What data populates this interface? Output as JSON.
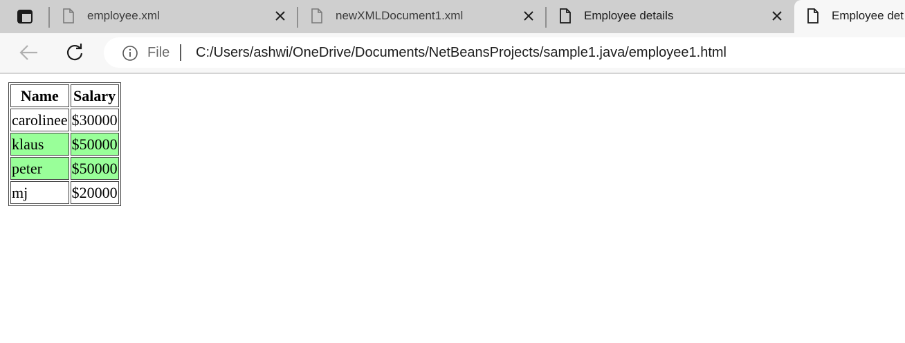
{
  "tabs": [
    {
      "title": "employee.xml",
      "icon": "file-icon",
      "active": false
    },
    {
      "title": "newXMLDocument1.xml",
      "icon": "file-icon",
      "active": false
    },
    {
      "title": "Employee details",
      "icon": "file-icon",
      "active": false
    },
    {
      "title": "Employee det",
      "icon": "file-icon",
      "active": true
    }
  ],
  "address_bar": {
    "scheme_label": "File",
    "url": "C:/Users/ashwi/OneDrive/Documents/NetBeansProjects/sample1.java/employee1.html"
  },
  "table": {
    "headers": [
      "Name",
      "Salary"
    ],
    "rows": [
      {
        "name": "carolinee",
        "salary": "$30000",
        "highlight": false
      },
      {
        "name": "klaus",
        "salary": "$50000",
        "highlight": true
      },
      {
        "name": "peter",
        "salary": "$50000",
        "highlight": true
      },
      {
        "name": "mj",
        "salary": "$20000",
        "highlight": false
      }
    ],
    "highlight_color": "#99ff99"
  }
}
